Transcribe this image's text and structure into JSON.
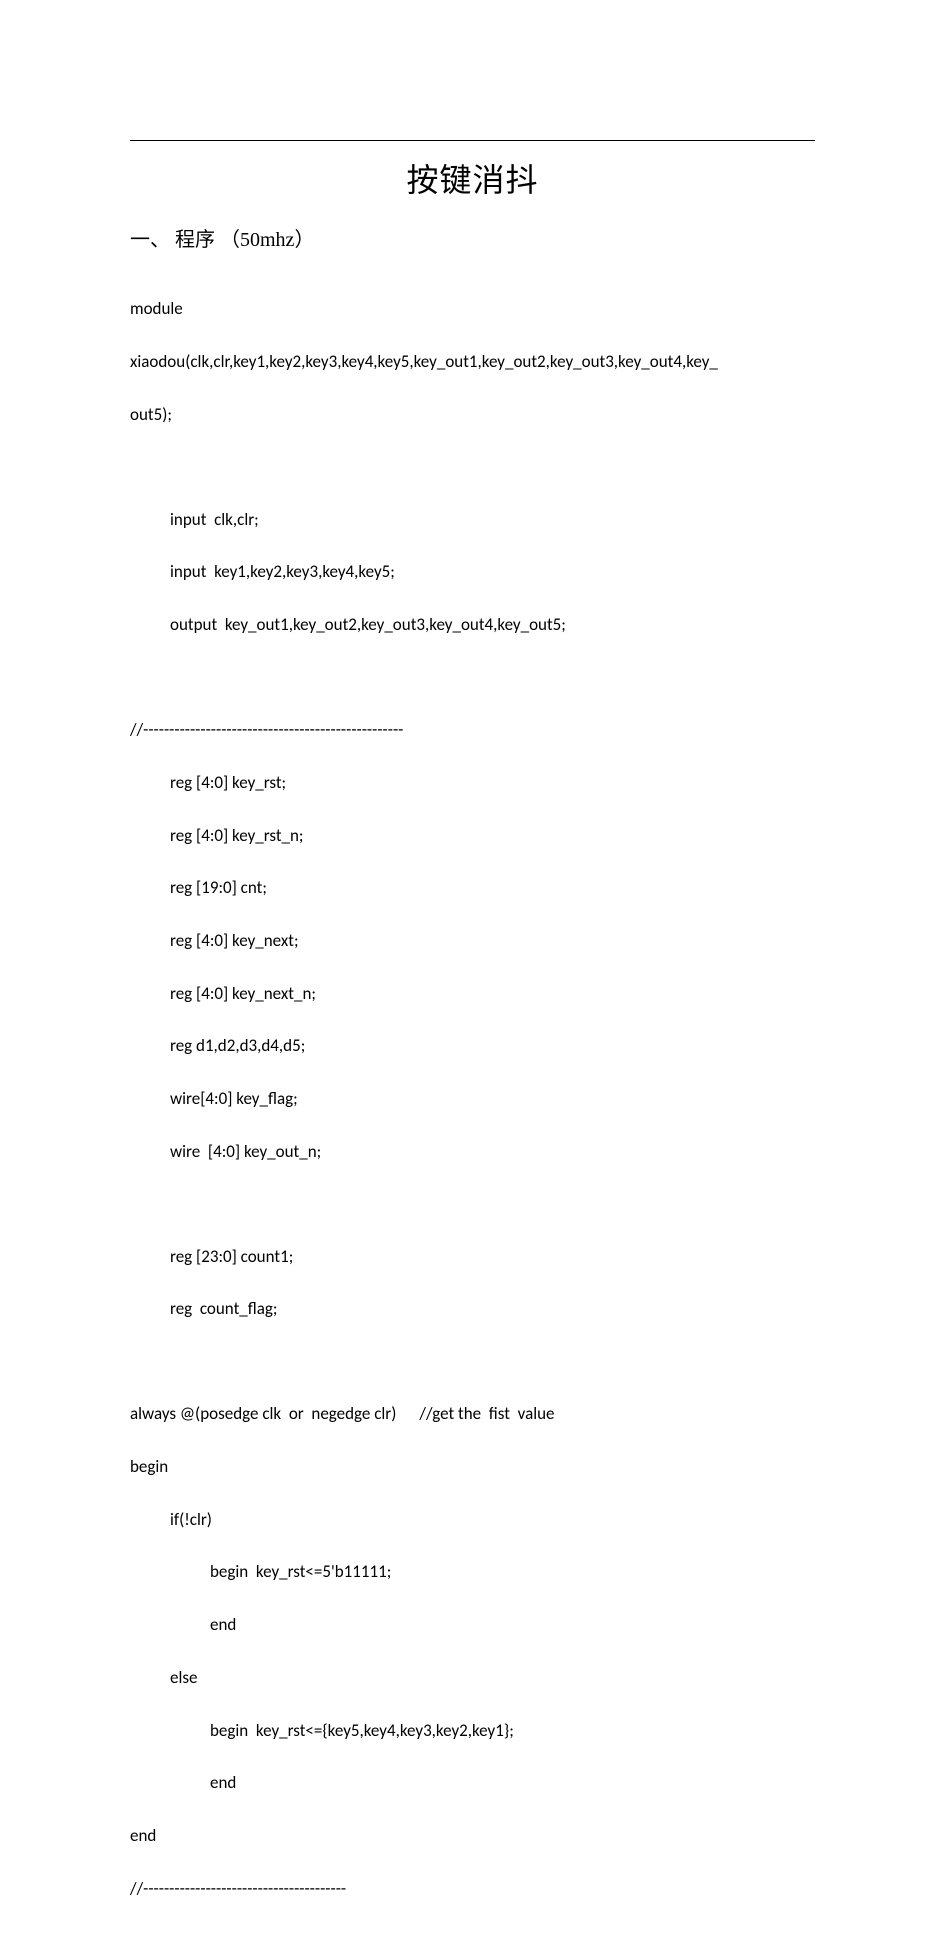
{
  "title": "按键消抖",
  "section1": {
    "number": "一、",
    "label": "程序",
    "paren_open": "（",
    "freq": "50mhz",
    "paren_close": "）"
  },
  "code": {
    "l01": "module",
    "l02": "xiaodou(clk,clr,key1,key2,key3,key4,key5,key_out1,key_out2,key_out3,key_out4,key_",
    "l03": "out5);",
    "l04": "input  clk,clr;",
    "l05": "input  key1,key2,key3,key4,key5;",
    "l06": "output  key_out1,key_out2,key_out3,key_out4,key_out5;",
    "l07": "//--------------------------------------------------",
    "l08": "reg [4:0] key_rst;",
    "l09": "reg [4:0] key_rst_n;",
    "l10": "reg [19:0] cnt;",
    "l11": "reg [4:0] key_next;",
    "l12": "reg [4:0] key_next_n;",
    "l13": "reg d1,d2,d3,d4,d5;",
    "l14": "wire[4:0] key_flag;",
    "l15": "wire  [4:0] key_out_n;",
    "l16": "reg [23:0] count1;",
    "l17": "reg  count_flag;",
    "l18": "always @(posedge clk  or  negedge clr)      //get the  fist  value",
    "l19": "begin",
    "l20": "if(!clr)",
    "l21": "begin  key_rst<=5'b11111;",
    "l22": "end",
    "l23": "else",
    "l24": "begin  key_rst<={key5,key4,key3,key2,key1};",
    "l25": "end",
    "l26": "end",
    "l27": "//---------------------------------------"
  }
}
